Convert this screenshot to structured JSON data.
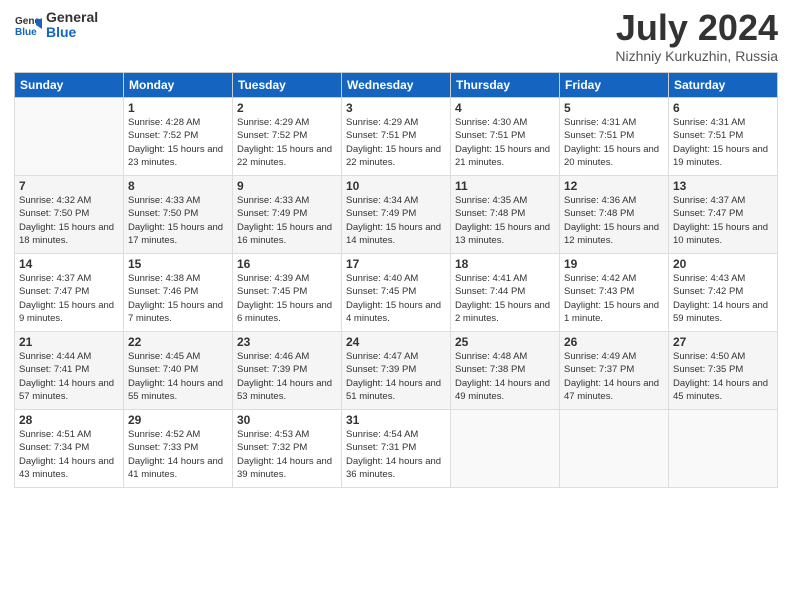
{
  "logo": {
    "general": "General",
    "blue": "Blue"
  },
  "title": "July 2024",
  "location": "Nizhniy Kurkuzhin, Russia",
  "weekdays": [
    "Sunday",
    "Monday",
    "Tuesday",
    "Wednesday",
    "Thursday",
    "Friday",
    "Saturday"
  ],
  "weeks": [
    [
      {
        "day": "",
        "sunrise": "",
        "sunset": "",
        "daylight": ""
      },
      {
        "day": "1",
        "sunrise": "4:28 AM",
        "sunset": "7:52 PM",
        "daylight": "15 hours and 23 minutes."
      },
      {
        "day": "2",
        "sunrise": "4:29 AM",
        "sunset": "7:52 PM",
        "daylight": "15 hours and 22 minutes."
      },
      {
        "day": "3",
        "sunrise": "4:29 AM",
        "sunset": "7:51 PM",
        "daylight": "15 hours and 22 minutes."
      },
      {
        "day": "4",
        "sunrise": "4:30 AM",
        "sunset": "7:51 PM",
        "daylight": "15 hours and 21 minutes."
      },
      {
        "day": "5",
        "sunrise": "4:31 AM",
        "sunset": "7:51 PM",
        "daylight": "15 hours and 20 minutes."
      },
      {
        "day": "6",
        "sunrise": "4:31 AM",
        "sunset": "7:51 PM",
        "daylight": "15 hours and 19 minutes."
      }
    ],
    [
      {
        "day": "7",
        "sunrise": "4:32 AM",
        "sunset": "7:50 PM",
        "daylight": "15 hours and 18 minutes."
      },
      {
        "day": "8",
        "sunrise": "4:33 AM",
        "sunset": "7:50 PM",
        "daylight": "15 hours and 17 minutes."
      },
      {
        "day": "9",
        "sunrise": "4:33 AM",
        "sunset": "7:49 PM",
        "daylight": "15 hours and 16 minutes."
      },
      {
        "day": "10",
        "sunrise": "4:34 AM",
        "sunset": "7:49 PM",
        "daylight": "15 hours and 14 minutes."
      },
      {
        "day": "11",
        "sunrise": "4:35 AM",
        "sunset": "7:48 PM",
        "daylight": "15 hours and 13 minutes."
      },
      {
        "day": "12",
        "sunrise": "4:36 AM",
        "sunset": "7:48 PM",
        "daylight": "15 hours and 12 minutes."
      },
      {
        "day": "13",
        "sunrise": "4:37 AM",
        "sunset": "7:47 PM",
        "daylight": "15 hours and 10 minutes."
      }
    ],
    [
      {
        "day": "14",
        "sunrise": "4:37 AM",
        "sunset": "7:47 PM",
        "daylight": "15 hours and 9 minutes."
      },
      {
        "day": "15",
        "sunrise": "4:38 AM",
        "sunset": "7:46 PM",
        "daylight": "15 hours and 7 minutes."
      },
      {
        "day": "16",
        "sunrise": "4:39 AM",
        "sunset": "7:45 PM",
        "daylight": "15 hours and 6 minutes."
      },
      {
        "day": "17",
        "sunrise": "4:40 AM",
        "sunset": "7:45 PM",
        "daylight": "15 hours and 4 minutes."
      },
      {
        "day": "18",
        "sunrise": "4:41 AM",
        "sunset": "7:44 PM",
        "daylight": "15 hours and 2 minutes."
      },
      {
        "day": "19",
        "sunrise": "4:42 AM",
        "sunset": "7:43 PM",
        "daylight": "15 hours and 1 minute."
      },
      {
        "day": "20",
        "sunrise": "4:43 AM",
        "sunset": "7:42 PM",
        "daylight": "14 hours and 59 minutes."
      }
    ],
    [
      {
        "day": "21",
        "sunrise": "4:44 AM",
        "sunset": "7:41 PM",
        "daylight": "14 hours and 57 minutes."
      },
      {
        "day": "22",
        "sunrise": "4:45 AM",
        "sunset": "7:40 PM",
        "daylight": "14 hours and 55 minutes."
      },
      {
        "day": "23",
        "sunrise": "4:46 AM",
        "sunset": "7:39 PM",
        "daylight": "14 hours and 53 minutes."
      },
      {
        "day": "24",
        "sunrise": "4:47 AM",
        "sunset": "7:39 PM",
        "daylight": "14 hours and 51 minutes."
      },
      {
        "day": "25",
        "sunrise": "4:48 AM",
        "sunset": "7:38 PM",
        "daylight": "14 hours and 49 minutes."
      },
      {
        "day": "26",
        "sunrise": "4:49 AM",
        "sunset": "7:37 PM",
        "daylight": "14 hours and 47 minutes."
      },
      {
        "day": "27",
        "sunrise": "4:50 AM",
        "sunset": "7:35 PM",
        "daylight": "14 hours and 45 minutes."
      }
    ],
    [
      {
        "day": "28",
        "sunrise": "4:51 AM",
        "sunset": "7:34 PM",
        "daylight": "14 hours and 43 minutes."
      },
      {
        "day": "29",
        "sunrise": "4:52 AM",
        "sunset": "7:33 PM",
        "daylight": "14 hours and 41 minutes."
      },
      {
        "day": "30",
        "sunrise": "4:53 AM",
        "sunset": "7:32 PM",
        "daylight": "14 hours and 39 minutes."
      },
      {
        "day": "31",
        "sunrise": "4:54 AM",
        "sunset": "7:31 PM",
        "daylight": "14 hours and 36 minutes."
      },
      {
        "day": "",
        "sunrise": "",
        "sunset": "",
        "daylight": ""
      },
      {
        "day": "",
        "sunrise": "",
        "sunset": "",
        "daylight": ""
      },
      {
        "day": "",
        "sunrise": "",
        "sunset": "",
        "daylight": ""
      }
    ]
  ]
}
